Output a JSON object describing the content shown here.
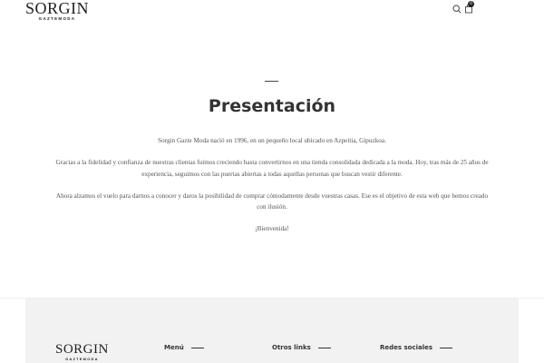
{
  "header": {
    "logo_main": "SORGIN",
    "logo_sub": "GAZTEMODA",
    "cart_count": "0"
  },
  "main": {
    "title": "Presentación",
    "paragraphs": [
      "Sorgin Gazte Moda nació en 1996, en un pequeño local ubicado en Azpeitia, Gipuzkoa.",
      "Gracias a la fidelidad y confianza de nuestras clientas fuimos creciendo hasta convertirnos en una tienda consolidada dedicada a la moda. Hoy, tras más de 25 años de experiencia, seguimos con las puertas abiertas a todas aquellas personas que buscan vestir diferente.",
      "Ahora alzamos el vuelo para darnos a conocer y daros la posibilidad de comprar cómodamente desde vuestras casas. Ese es el objetivo de esta web que hemos creado con ilusión.",
      "¡Bienvenida!"
    ]
  },
  "footer": {
    "logo_main": "SORGIN",
    "logo_sub": "GAZTEMODA",
    "headings": {
      "menu": "Menú",
      "links": "Otros links",
      "social": "Redes sociales"
    }
  },
  "icons": {
    "search": "search-icon",
    "cart": "shopping-bag-icon"
  },
  "colors": {
    "text": "#333333",
    "footer_bg": "#f2f2f2"
  }
}
